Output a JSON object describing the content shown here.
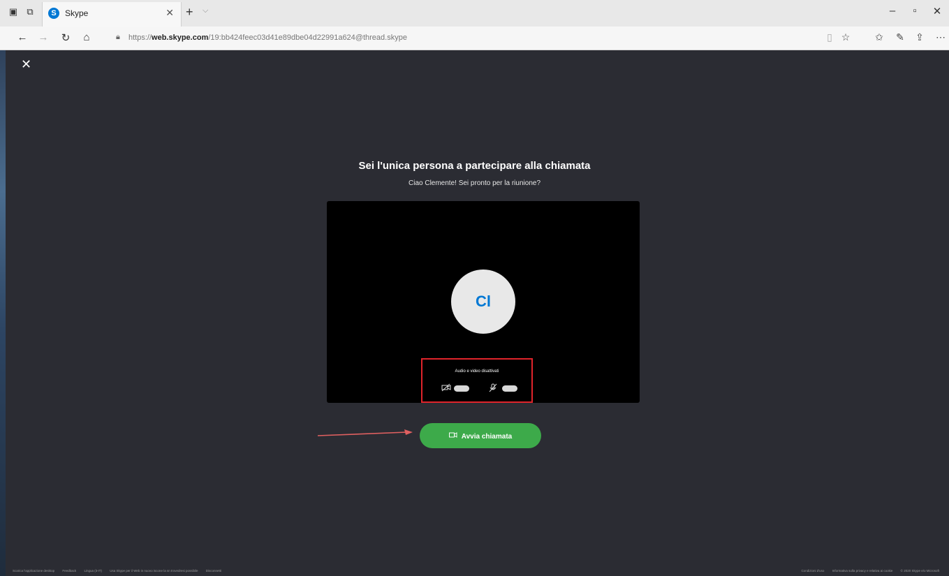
{
  "browser": {
    "tab_title": "Skype",
    "favicon_letter": "S",
    "url_prefix": "https://",
    "url_domain": "web.skype.com",
    "url_path": "/19:bb424feec03d41e89dbe04d22991a624@thread.skype"
  },
  "call": {
    "heading": "Sei l'unica persona a partecipare alla chiamata",
    "subheading": "Ciao Clemente! Sei pronto per la riunione?",
    "avatar_initials": "Cl",
    "av_status": "Audio e video disattivati",
    "start_button": "Avvia chiamata"
  },
  "footer": {
    "left": [
      "Scarica l'applicazione desktop",
      "Feedback",
      "Lingua (it-IT)",
      "Usa Skype per il Web in nuovo iscone la sn trovedresi possibile",
      "Disconnetti"
    ],
    "right": [
      "Condizioni d'uso",
      "Informativa sulla privacy e relativa ai cookie",
      "© 2020 Skype e/o Microsoft"
    ]
  },
  "colors": {
    "background": "#2b2c33",
    "accent_green": "#3daa4a",
    "highlight_red": "#e0242b",
    "skype_blue": "#0078d4"
  },
  "icons": {
    "camera_off": "camera-off-icon",
    "mic_off": "mic-off-icon",
    "video_call": "video-camera-icon"
  }
}
